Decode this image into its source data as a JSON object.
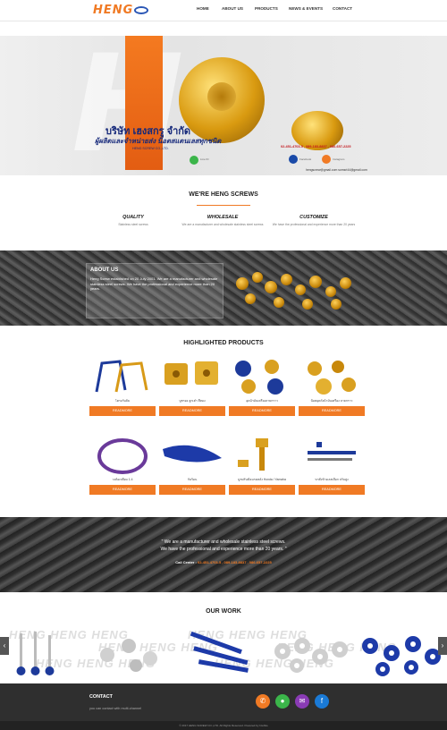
{
  "header": {
    "logo_text": "HENG",
    "nav": [
      "HOME",
      "ABOUT US",
      "PRODUCTS",
      "NEWS & EVENTS",
      "CONTACT"
    ]
  },
  "hero": {
    "company_th": "บริษัท เฮงสกรู จำกัด",
    "tagline_th": "ผู้ผลิตและจำหน่ายส่ง น๊อตสแตนเลสทุกชนิด",
    "company_en": "HENG SCREW CO.,LTD.",
    "line_label": "Line ID",
    "fb_label": "Facebook",
    "ig_label": "Instagram",
    "phones": "02-451-4703-5 , 089-183-8837 , 086-657-2225",
    "emails": "hengscrew@gmail.com   somsri44@gmail.com"
  },
  "we_are": {
    "title": "WE'RE HENG SCREWS",
    "features": [
      {
        "title": "QUALITY",
        "text": "Stainless steel screws"
      },
      {
        "title": "WHOLESALE",
        "text": "We are a manufacturer and wholesale stainless steel screws"
      },
      {
        "title": "CUSTOMIZE",
        "text": "We have the professional and experience more than 20 years"
      }
    ]
  },
  "about": {
    "title": "ABOUT US",
    "text": "Heng Screw established on 20 July 2001. We are a manufacturer and wholesale stainless steel screws. We have the professional and experience more than 20 years."
  },
  "products": {
    "title": "HIGHLIGHTED PRODUCTS",
    "button_label": "READMORE",
    "items": [
      {
        "caption": "โครงกันล้ม"
      },
      {
        "caption": "บูชรอง ลูกเต๋า สีทอง"
      },
      {
        "caption": "อุดน้ำมันเครื่องลายกราว"
      },
      {
        "caption": "น็อตอุดถังน้ำมันเครื่อง ลายกราว"
      },
      {
        "caption": "วงล้อเหลือบ 1.4"
      },
      {
        "caption": "กันร้อน"
      },
      {
        "caption": "บูชปรับตั้งเบรคหลัง Honda / Yamaha"
      },
      {
        "caption": "ขาตั้งข้างเลสเลือก ปรับสูง"
      }
    ]
  },
  "quote": {
    "line1": "\" We are a manufacturer and wholesale stainless steel screws.",
    "line2": "We have the professional and experience more than 20 years. \"",
    "call_label": "Call Center :",
    "call_numbers": "02-451-4703-5 , 089-183-8837 , 086-657-2225"
  },
  "work": {
    "title": "OUR WORK",
    "watermark": "HENG HENG HENG"
  },
  "contact": {
    "title": "CONTACT",
    "text": "you can contact with multi-channel",
    "footer": "© 2017 HENG SCREW CO.,LTD. All Rights Reserved. Powered by Inwhite"
  },
  "colors": {
    "accent": "#f07a24",
    "navy": "#15287a",
    "dark": "#2f2f2f"
  }
}
